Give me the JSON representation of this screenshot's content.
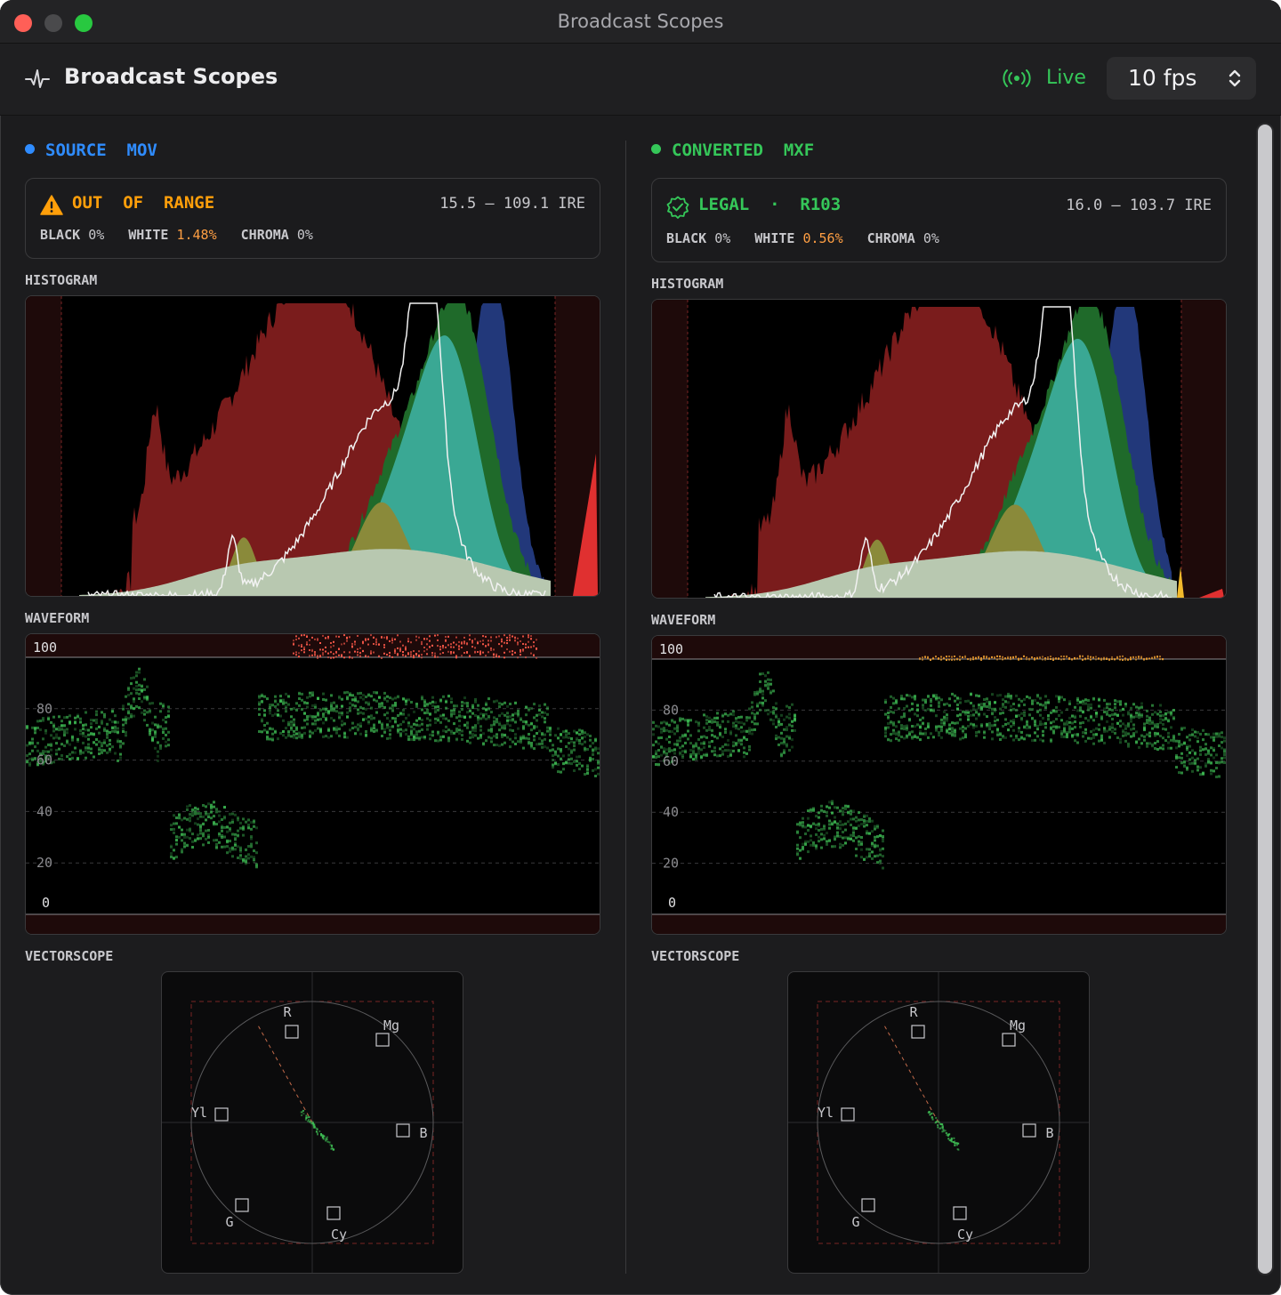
{
  "window": {
    "title": "Broadcast Scopes"
  },
  "toolbar": {
    "app_title": "Broadcast Scopes",
    "app_icon": "waveform-pulse-icon",
    "live_icon": "broadcast-antenna-icon",
    "live_label": "Live",
    "fps_value": "10 fps"
  },
  "colors": {
    "source_accent": "#2f8cff",
    "converted_accent": "#35c759",
    "warning": "#ff9f0a",
    "legal": "#35c759",
    "out_of_range_value": "#ff9f43"
  },
  "panels": [
    {
      "name": "SOURCE  MOV",
      "status": {
        "title": "OUT  OF  RANGE",
        "icon": "warning-triangle-icon",
        "range": "15.5 — 109.1 IRE",
        "black_label": "BLACK",
        "black_value": "0%",
        "white_label": "WHITE",
        "white_value": "1.48%",
        "chroma_label": "CHROMA",
        "chroma_value": "0%"
      },
      "histogram_label": "HISTOGRAM",
      "waveform_label": "WAVEFORM",
      "waveform_ticks": [
        "100",
        "80",
        "60",
        "40",
        "20",
        "0"
      ],
      "vectorscope_label": "VECTORSCOPE",
      "vector_targets": [
        "R",
        "Mg",
        "B",
        "Cy",
        "G",
        "Yl"
      ]
    },
    {
      "name": "CONVERTED  MXF",
      "status": {
        "title": "LEGAL  ·  R103",
        "icon": "checkmark-seal-icon",
        "range": "16.0 — 103.7 IRE",
        "black_label": "BLACK",
        "black_value": "0%",
        "white_label": "WHITE",
        "white_value": "0.56%",
        "chroma_label": "CHROMA",
        "chroma_value": "0%"
      },
      "histogram_label": "HISTOGRAM",
      "waveform_label": "WAVEFORM",
      "waveform_ticks": [
        "100",
        "80",
        "60",
        "40",
        "20",
        "0"
      ],
      "vectorscope_label": "VECTORSCOPE",
      "vector_targets": [
        "R",
        "Mg",
        "B",
        "Cy",
        "G",
        "Yl"
      ]
    }
  ]
}
